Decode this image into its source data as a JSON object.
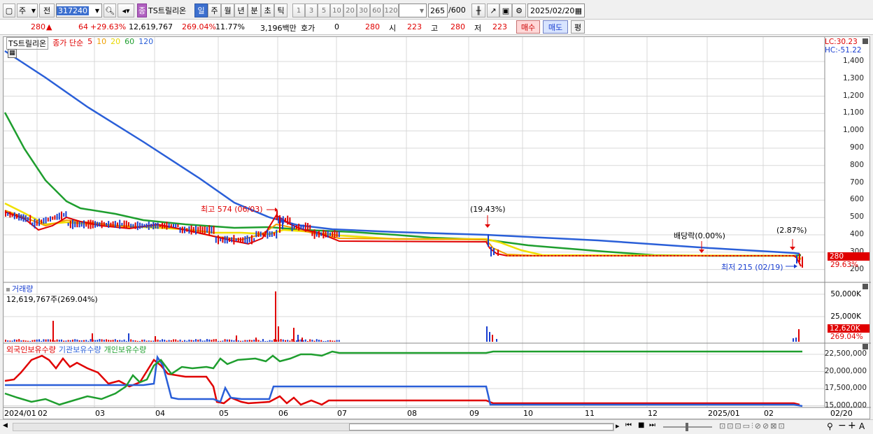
{
  "toolbar": {
    "period_select": "주",
    "prev_label": "전",
    "code": "317240",
    "name_badge": "종",
    "stock_name": "TS트릴리온",
    "tf_buttons": [
      "일",
      "주",
      "월",
      "년",
      "분",
      "초",
      "틱"
    ],
    "tf_selected": "일",
    "num_buttons": [
      "1",
      "3",
      "5",
      "10",
      "20",
      "30",
      "60",
      "120"
    ],
    "count": "265",
    "count_total": "/600",
    "date": "2025/02/20"
  },
  "quote": {
    "price": "280",
    "change": "64",
    "change_pct": "+29.63%",
    "volume": "12,619,767",
    "vol_ratio": "269.04%",
    "turnover": "11.77%",
    "amount": "3,196백만",
    "hoga_label": "호가",
    "hoga_val": "0",
    "hoga_price": "280",
    "open_label": "시",
    "open_val": "223",
    "high_label": "고",
    "high_val": "280",
    "low_label": "저",
    "low_val": "223",
    "buy_btn": "매수",
    "sell_btn": "매도",
    "eval_btn": "평"
  },
  "chart": {
    "legend_name": "TS트릴리온",
    "legend_type": "종가 단순",
    "ma": [
      {
        "label": "5",
        "color": "#e00000"
      },
      {
        "label": "10",
        "color": "#f0a000"
      },
      {
        "label": "20",
        "color": "#e8d800"
      },
      {
        "label": "60",
        "color": "#1e9e2e"
      },
      {
        "label": "120",
        "color": "#2a5fd8"
      }
    ],
    "lc": "LC:30.23",
    "hc": "HC:-51.22",
    "y_ticks": [
      "1,400",
      "1,300",
      "1,200",
      "1,100",
      "1,000",
      "900",
      "800",
      "700",
      "600",
      "500",
      "400",
      "300",
      "200"
    ],
    "price_tag": "280",
    "price_tag_pct": "29.63%",
    "ann_high": "최고 574 (06/03)",
    "ann_1943": "(19.43%)",
    "ann_div": "배당락(0.00%)",
    "ann_287": "(2.87%)",
    "ann_low": "최저 215 (02/19)",
    "vol_title": "거래량",
    "vol_value": "12,619,767주(269.04%)",
    "vol_ticks": [
      "50,000K",
      "25,000K"
    ],
    "vol_tag": "12,620K",
    "vol_tag_pct": "269.04%",
    "hold_legend": [
      "외국인보유수량",
      "기관보유수량",
      "개인보유수량"
    ],
    "hold_colors": [
      "#e00000",
      "#2a5fd8",
      "#1e9e2e"
    ],
    "hold_ticks": [
      "22,500,000",
      "20,000,000",
      "17,500,000",
      "15,000,000"
    ],
    "x_labels": [
      "2024/01",
      "02",
      "03",
      "04",
      "05",
      "06",
      "07",
      "08",
      "09",
      "10",
      "11",
      "12",
      "2025/01",
      "02"
    ],
    "x_end": "02/20"
  }
}
